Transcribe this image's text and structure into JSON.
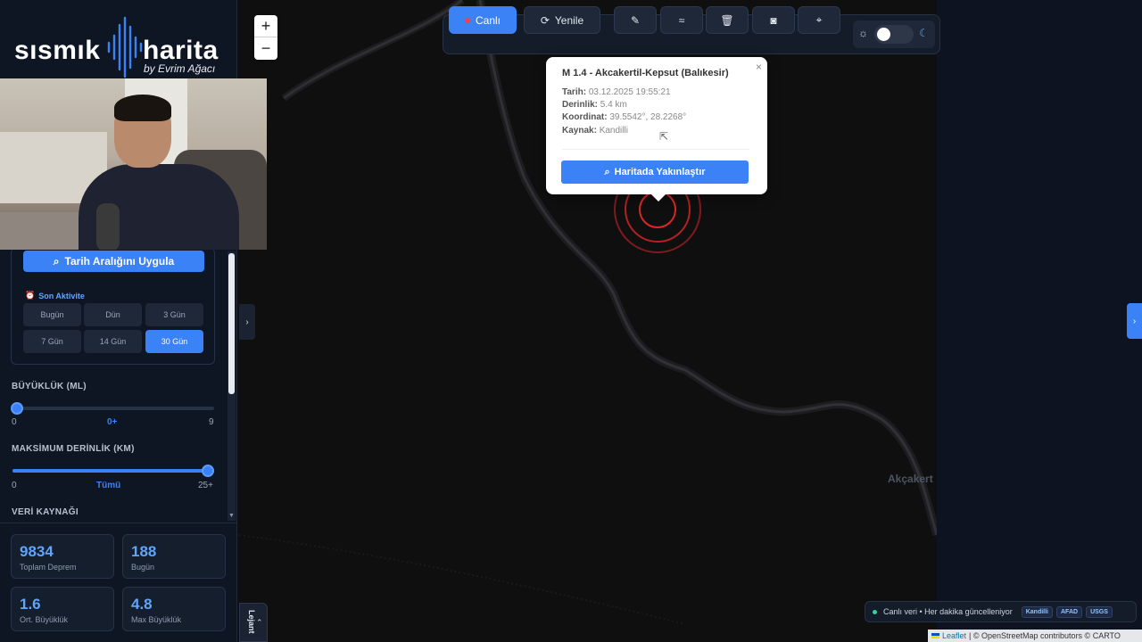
{
  "brand": {
    "left": "sısmık",
    "right": "harita",
    "byline": "by Evrim Ağacı"
  },
  "filters": {
    "apply_range": "Tarih Aralığını Uygula",
    "recent_title": "Son Aktivite",
    "days": [
      "Bugün",
      "Dün",
      "3 Gün",
      "7 Gün",
      "14 Gün",
      "30 Gün"
    ],
    "active_day": "30 Gün",
    "magnitude": {
      "label": "BÜYÜKLÜK (ML)",
      "min": "0",
      "mid": "0+",
      "max": "9",
      "value": 0
    },
    "depth": {
      "label": "MAKSİMUM DERİNLİK (KM)",
      "min": "0",
      "mid": "Tümü",
      "max": "25+",
      "value": 25
    },
    "source_label": "VERİ KAYNAĞI"
  },
  "stats": [
    {
      "value": "9834",
      "label": "Toplam Deprem"
    },
    {
      "value": "188",
      "label": "Bugün"
    },
    {
      "value": "1.6",
      "label": "Ort. Büyüklük"
    },
    {
      "value": "4.8",
      "label": "Max Büyüklük"
    }
  ],
  "toolbar": {
    "live": "Canlı",
    "refresh": "Yenile"
  },
  "zoom": {
    "in": "+",
    "out": "−"
  },
  "popup": {
    "title": "M 1.4 - Akcakertil-Kepsut (Balıkesir)",
    "rows": [
      {
        "k": "Tarih:",
        "v": "03.12.2025 19:55:21"
      },
      {
        "k": "Derinlik:",
        "v": "5.4 km"
      },
      {
        "k": "Koordinat:",
        "v": "39.5542°, 28.2268°"
      },
      {
        "k": "Kaynak:",
        "v": "Kandilli"
      }
    ],
    "zoom_button": "Haritada Yakınlaştır"
  },
  "map": {
    "town_label": "Akçakert",
    "legend": "Lejant"
  },
  "status": {
    "text": "Canlı veri • Her dakika güncelleniyor",
    "sources": [
      "Kandilli",
      "AFAD",
      "USGS"
    ]
  },
  "attribution": {
    "leaflet": "Leaflet",
    "rest": "| © OpenStreetMap contributors © CARTO"
  },
  "colors": {
    "accent": "#3b82f6",
    "marker": "#dc2626",
    "panel": "#0f1623"
  }
}
